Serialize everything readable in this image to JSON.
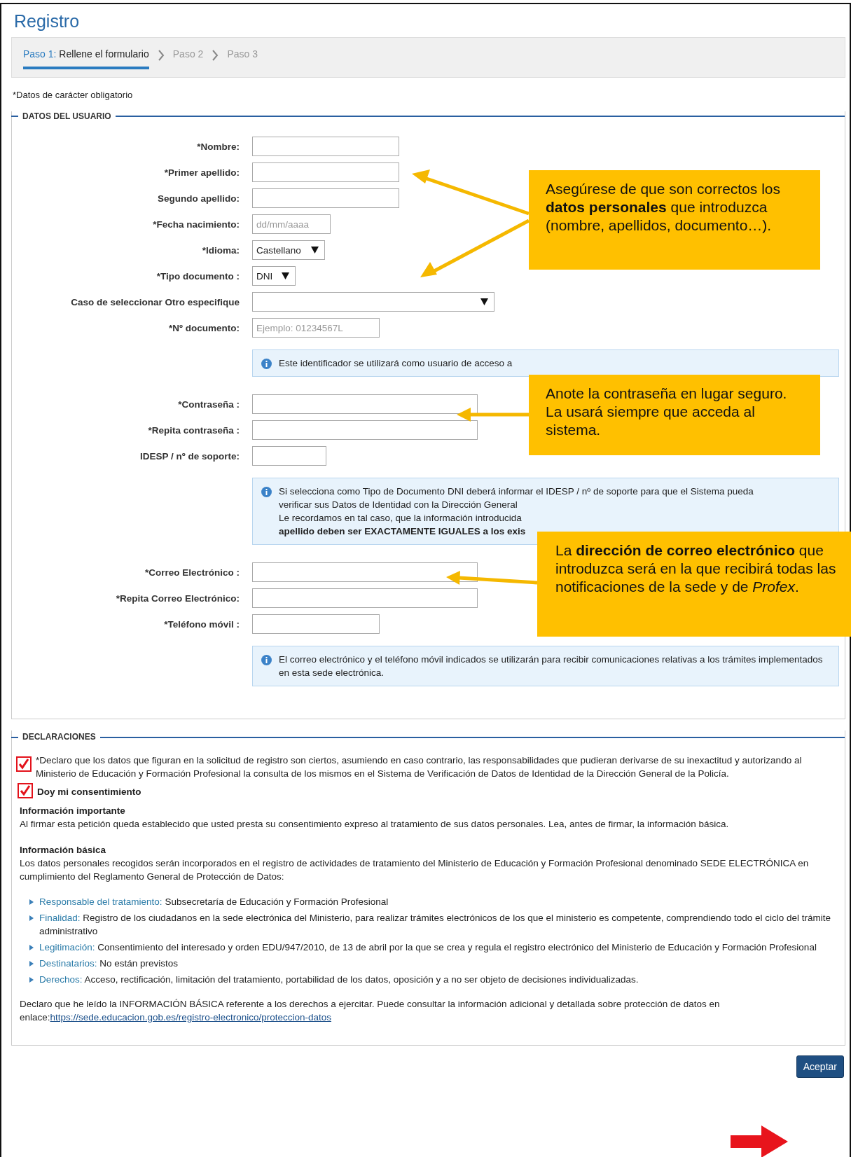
{
  "title": "Registro",
  "steps": [
    {
      "number": "Paso 1:",
      "label": "Rellene el formulario",
      "selected": true
    },
    {
      "number": "Paso 2",
      "selected": false
    },
    {
      "number": "Paso 3",
      "selected": false
    }
  ],
  "required_note": "*Datos de carácter obligatorio",
  "user_section": {
    "legend": "DATOS DEL USUARIO",
    "fields": [
      {
        "label": "*Nombre:",
        "kind": "text"
      },
      {
        "label": "*Primer apellido:",
        "kind": "text"
      },
      {
        "label": "Segundo apellido:",
        "kind": "text"
      },
      {
        "label": "*Fecha nacimiento:",
        "kind": "date",
        "placeholder": "dd/mm/aaaa"
      },
      {
        "label": "*Idioma:",
        "kind": "select",
        "value": "Castellano"
      },
      {
        "label": "*Tipo documento :",
        "kind": "select",
        "value": "DNI"
      },
      {
        "label": "Caso de seleccionar Otro especifique",
        "kind": "select"
      },
      {
        "label": "*Nº documento:",
        "kind": "doc",
        "placeholder": "Ejemplo: 01234567L"
      },
      {
        "kind": "info",
        "lines": [
          "Este identificador se utilizará como usuario de acceso a"
        ]
      },
      {
        "label": "*Contraseña :",
        "kind": "wide"
      },
      {
        "label": "*Repita contraseña :",
        "kind": "wide"
      },
      {
        "label": "IDESP / nº de soporte:",
        "kind": "short"
      },
      {
        "kind": "info",
        "lines": [
          "Si selecciona como Tipo de Documento DNI deberá informar el IDESP / nº de soporte para que el Sistema pueda",
          "verificar sus Datos de Identidad con la Dirección General",
          "Le recordamos en tal caso, que la información introducida",
          "**apellido deben ser EXACTAMENTE IGUALES a los exis**"
        ]
      },
      {
        "label": "*Correo Electrónico :",
        "kind": "wide"
      },
      {
        "label": "*Repita Correo Electrónico:",
        "kind": "wide"
      },
      {
        "label": "*Teléfono móvil :",
        "kind": "doc"
      },
      {
        "kind": "info",
        "text": "El correo electrónico y el teléfono móvil indicados se utilizarán para recibir comunicaciones relativas a los trámites implementados en esta sede electrónica."
      }
    ]
  },
  "declarations": {
    "legend": "DECLARACIONES",
    "checks": [
      {
        "text": "*Declaro que los datos que figuran en la solicitud de registro son ciertos, asumiendo en caso contrario, las responsabilidades que pudieran derivarse de su inexactitud y autorizando al Ministerio de Educación y Formación Profesional la consulta de los mismos en el Sistema de Verificación de Datos de Identidad de la Dirección General de la Policía.",
        "checked": true,
        "kind": "plain"
      },
      {
        "text": "Doy mi consentimiento",
        "checked": true,
        "kind": "strong"
      }
    ],
    "important_title": "Información importante",
    "important_text": "Al firmar esta petición queda establecido que usted presta su consentimiento expreso al tratamiento de sus datos personales. Lea, antes de firmar, la información básica.",
    "basic_title": "Información básica",
    "basic_text": "Los datos personales recogidos serán incorporados en el registro de actividades de tratamiento del Ministerio de Educación y Formación Profesional denominado SEDE ELECTRÓNICA en cumplimiento del Reglamento General de Protección de Datos:",
    "items": [
      {
        "term": "Responsable del tratamiento:",
        "text": "Subsecretaría de Educación y Formación Profesional"
      },
      {
        "term": "Finalidad:",
        "text": "Registro de los ciudadanos en la sede electrónica del Ministerio, para realizar trámites electrónicos de los que el ministerio es competente, comprendiendo todo el ciclo del trámite administrativo"
      },
      {
        "term": "Legitimación:",
        "text": "Consentimiento del interesado y orden EDU/947/2010, de 13 de abril por la que se crea y regula el registro electrónico del Ministerio de Educación y Formación Profesional"
      },
      {
        "term": "Destinatarios:",
        "text": "No están previstos"
      },
      {
        "term": "Derechos:",
        "text": "Acceso, rectificación, limitación del tratamiento, portabilidad de los datos, oposición y a no ser objeto de decisiones individualizadas."
      }
    ],
    "closing_text": "Declaro que he leído la INFORMACIÓN BÁSICA referente a los derechos a ejercitar. Puede consultar la información adicional y detallada sobre protección de datos en enlace:",
    "link": "https://sede.educacion.gob.es/registro-electronico/proteccion-datos"
  },
  "submit_button": "Aceptar",
  "callouts": [
    "Asegúrese de que son correctos los **datos personales** que introduzca (nombre, apellidos, documento…).",
    "Anote la contraseña en lugar seguro. La usará siempre que acceda al sistema.",
    "La **dirección de correo electrónico** que introduzca será en la que recibirá todas las notificaciones de la sede y de *Profex*."
  ]
}
